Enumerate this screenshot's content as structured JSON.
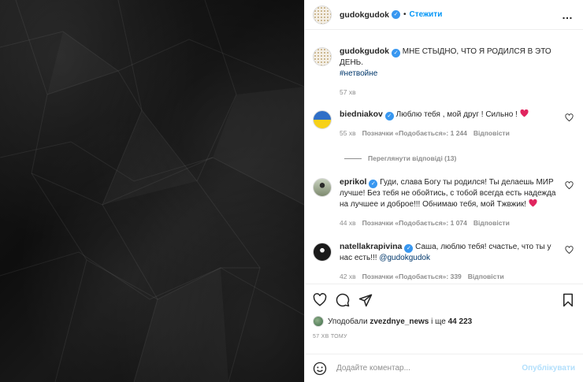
{
  "post": {
    "author": "gudokgudok",
    "dot": "•",
    "follow_label": "Стежити",
    "more_icon": "…"
  },
  "caption": {
    "user": "gudokgudok",
    "text": "МНЕ СТЫДНО, ЧТО Я РОДИЛСЯ В ЭТО ДЕНЬ.",
    "hashtag": "#нетвойне",
    "time": "57 хв"
  },
  "comments": [
    {
      "user": "biedniakov",
      "text": "Люблю тебя , мой друг ! Сильно !",
      "time": "55 хв",
      "likes": "Позначки «Подобається»: 1 244",
      "reply": "Відповісти"
    },
    {
      "user": "eprikol",
      "text": "Гуди, слава Богу ты родился! Ты делаешь МИР лучше! Без тебя не обойтись, с тобой всегда есть надежда на лучшее и доброе!!! Обнимаю тебя, мой Тжвжик!",
      "time": "44 хв",
      "likes": "Позначки «Подобається»: 1 074",
      "reply": "Відповісти"
    },
    {
      "user": "natellakrapivina",
      "text": "Саша, люблю тебя! счастье, что ты у нас есть!!!",
      "mention": "@gudokgudok",
      "time": "42 хв",
      "likes": "Позначки «Подобається»: 339",
      "reply": "Відповісти"
    }
  ],
  "view_replies": "Переглянути відповіді (13)",
  "likes_line": {
    "prefix": "Уподобали",
    "user": "zvezdnye_news",
    "middle": "і ще",
    "count": "44 223"
  },
  "posted_ago": "57 ХВ ТОМУ",
  "add_comment": {
    "placeholder": "Додайте коментар...",
    "publish": "Опублікувати"
  },
  "colors": {
    "accent": "#0095f6",
    "like_red": "#ed4956",
    "verified": "#3897f0"
  }
}
